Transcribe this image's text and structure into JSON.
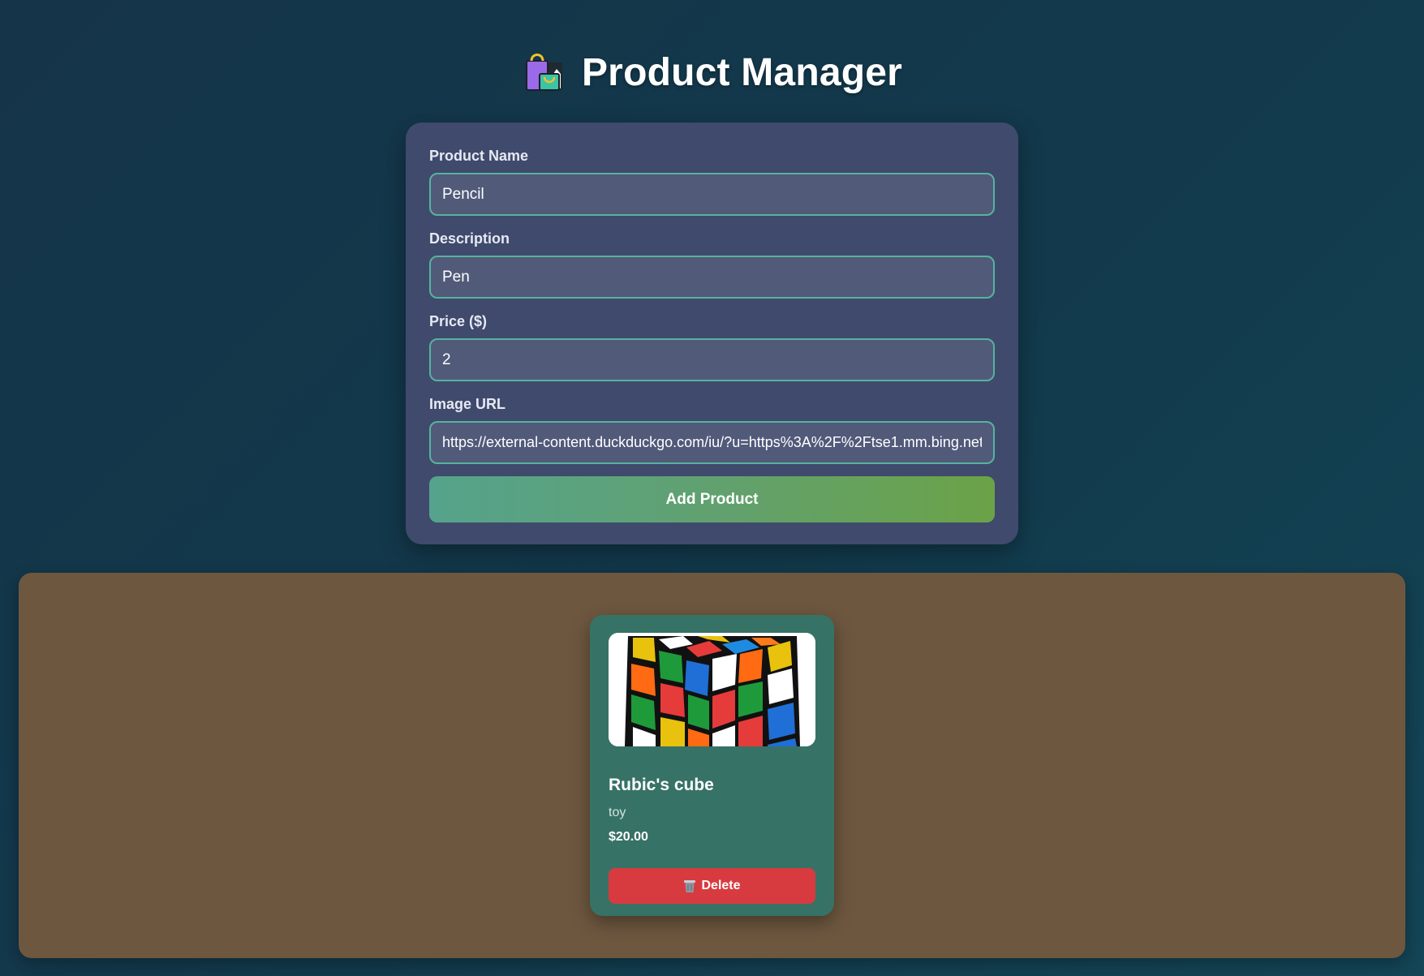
{
  "header": {
    "icon": "shopping-bags-icon",
    "title": "Product Manager"
  },
  "form": {
    "fields": [
      {
        "label": "Product Name",
        "value": "Pencil"
      },
      {
        "label": "Description",
        "value": "Pen"
      },
      {
        "label": "Price ($)",
        "value": "2"
      },
      {
        "label": "Image URL",
        "value": "https://external-content.duckduckgo.com/iu/?u=https%3A%2F%2Ftse1.mm.bing.net"
      }
    ],
    "submit_label": "Add Product"
  },
  "products": [
    {
      "image": "rubiks-cube-image",
      "name": "Rubic's cube",
      "description": "toy",
      "price": "$20.00",
      "delete_label": "Delete",
      "delete_icon": "trash-icon"
    }
  ],
  "colors": {
    "page_background": "#133a4c",
    "form_card": "#3f4a6d",
    "input_background": "#525a7a",
    "input_border": "#56b39d",
    "button_gradient_start": "#55a38c",
    "button_gradient_end": "#6ba247",
    "list_panel": "#6d573f",
    "product_card": "#377266",
    "delete_button": "#d83b3f"
  }
}
